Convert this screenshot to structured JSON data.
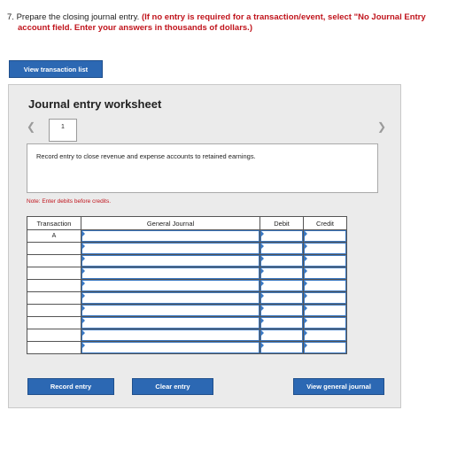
{
  "question": {
    "number": "7.",
    "text": "Prepare the closing journal entry.",
    "instruction_line1": "(If no entry is required for a transaction/event, select \"No Journal Entry",
    "instruction_line2": "account field. Enter your answers in thousands of dollars.)"
  },
  "buttons": {
    "view_transaction_list": "View transaction list",
    "record_entry": "Record entry",
    "clear_entry": "Clear entry",
    "view_general_journal": "View general journal"
  },
  "worksheet": {
    "title": "Journal entry worksheet",
    "current_page": "1",
    "prev_icon": "chevron-left-icon",
    "next_icon": "chevron-right-icon",
    "instruction": "Record entry to close revenue and expense accounts to retained earnings.",
    "note": "Note: Enter debits before credits."
  },
  "table": {
    "headers": [
      "Transaction",
      "General Journal",
      "Debit",
      "Credit"
    ],
    "rows": [
      {
        "transaction": "A"
      },
      {
        "transaction": ""
      },
      {
        "transaction": ""
      },
      {
        "transaction": ""
      },
      {
        "transaction": ""
      },
      {
        "transaction": ""
      },
      {
        "transaction": ""
      },
      {
        "transaction": ""
      },
      {
        "transaction": ""
      },
      {
        "transaction": ""
      }
    ]
  },
  "colors": {
    "accent": "#2c68b3",
    "red": "#c0141c",
    "panel": "#ebebeb"
  }
}
